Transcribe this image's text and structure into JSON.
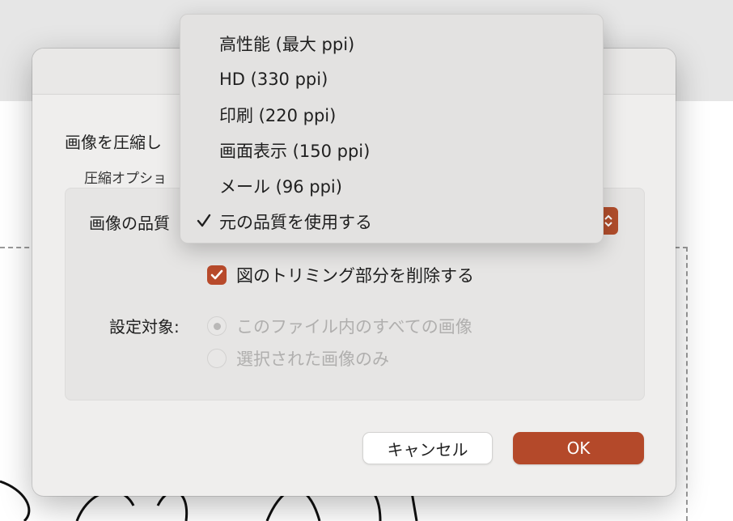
{
  "dialog": {
    "intro_text": "画像を圧縮し",
    "group_label": "圧縮オプショ",
    "quality_label": "画像の品質",
    "delete_crop_label": "図のトリミング部分を削除する",
    "delete_crop_checked": true,
    "target_label": "設定対象:",
    "target_options": [
      {
        "label": "このファイル内のすべての画像",
        "selected": true,
        "enabled": false
      },
      {
        "label": "選択された画像のみ",
        "selected": false,
        "enabled": false
      }
    ],
    "cancel_label": "キャンセル",
    "ok_label": "OK"
  },
  "quality_menu": {
    "items": [
      {
        "label": "高性能 (最大 ppi)",
        "checked": false
      },
      {
        "label": "HD (330 ppi)",
        "checked": false
      },
      {
        "label": "印刷 (220 ppi)",
        "checked": false
      },
      {
        "label": "画面表示 (150 ppi)",
        "checked": false
      },
      {
        "label": "メール (96 ppi)",
        "checked": false
      },
      {
        "label": "元の品質を使用する",
        "checked": true
      }
    ]
  },
  "colors": {
    "accent": "#b4492a",
    "dialog_bg": "#efeeed",
    "menu_bg": "#e3e2e1",
    "disabled_text": "#b0afae"
  },
  "icons": {
    "checkbox": "checkmark-icon",
    "menu_selected": "checkmark-icon",
    "popup": "chevron-updown-icon"
  }
}
